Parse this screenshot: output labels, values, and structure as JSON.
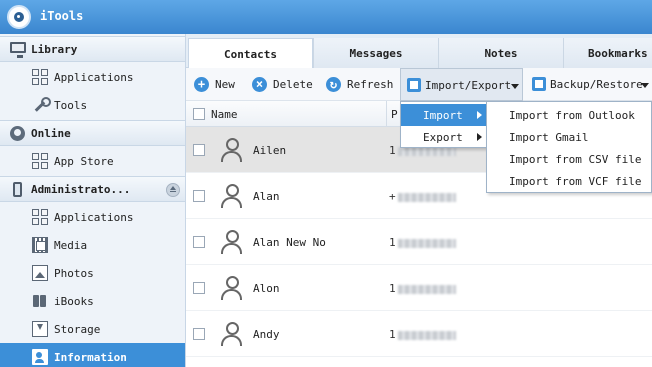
{
  "app": {
    "title": "iTools"
  },
  "sidebar": {
    "groups": [
      {
        "label": "Library",
        "items": [
          {
            "label": "Applications"
          },
          {
            "label": "Tools"
          }
        ]
      },
      {
        "label": "Online",
        "items": [
          {
            "label": "App Store"
          }
        ]
      },
      {
        "label": "Administrato...",
        "items": [
          {
            "label": "Applications"
          },
          {
            "label": "Media"
          },
          {
            "label": "Photos"
          },
          {
            "label": "iBooks"
          },
          {
            "label": "Storage"
          },
          {
            "label": "Information"
          }
        ]
      }
    ],
    "active_item": "Information"
  },
  "tabs": [
    {
      "label": "Contacts",
      "active": true
    },
    {
      "label": "Messages"
    },
    {
      "label": "Notes"
    },
    {
      "label": "Bookmarks"
    }
  ],
  "toolbar": {
    "new_label": "New",
    "delete_label": "Delete",
    "refresh_label": "Refresh",
    "import_export_label": "Import/Export",
    "backup_restore_label": "Backup/Restore"
  },
  "table": {
    "columns": {
      "name": "Name",
      "phone": "P"
    },
    "rows": [
      {
        "name": "Ailen",
        "phone_prefix": "1"
      },
      {
        "name": "Alan",
        "phone_prefix": "+"
      },
      {
        "name": "Alan New No",
        "phone_prefix": "1"
      },
      {
        "name": "Alon",
        "phone_prefix": "1"
      },
      {
        "name": "Andy",
        "phone_prefix": "1"
      }
    ],
    "selected_row": 0
  },
  "import_export_menu": {
    "items": [
      {
        "label": "Import",
        "highlighted": true
      },
      {
        "label": "Export"
      }
    ]
  },
  "import_submenu": {
    "items": [
      {
        "label": "Import from Outlook"
      },
      {
        "label": "Import Gmail"
      },
      {
        "label": "Import from CSV file"
      },
      {
        "label": "Import from VCF file"
      }
    ]
  },
  "colors": {
    "accent": "#3c8fd8",
    "titlebar": "#4a96da",
    "sidebar_bg": "#eef3f9"
  }
}
